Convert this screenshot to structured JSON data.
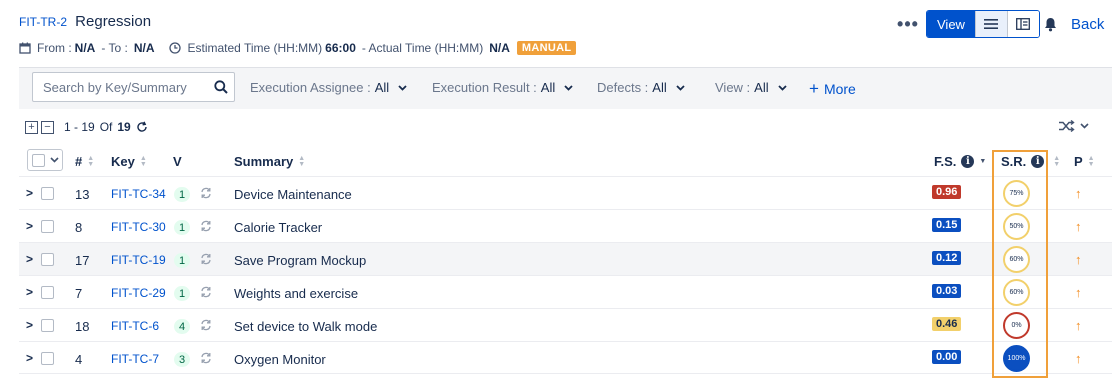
{
  "header": {
    "key": "FIT-TR-2",
    "name": "Regression",
    "from_label": "From :",
    "from_value": "N/A",
    "to_label": "- To :",
    "to_value": "N/A",
    "est_label": "Estimated Time (HH:MM)",
    "est_value": "66:00",
    "actual_label": "- Actual Time (HH:MM)",
    "actual_value": "N/A",
    "manual_badge": "MANUAL"
  },
  "toolbar": {
    "more_dots": "•••",
    "view_label": "View",
    "back_label": "Back"
  },
  "filters": {
    "search_placeholder": "Search by Key/Summary",
    "items": [
      {
        "label": "Execution Assignee :",
        "value": "All"
      },
      {
        "label": "Execution Result :",
        "value": "All"
      },
      {
        "label": "Defects :",
        "value": "All"
      },
      {
        "label": "View :",
        "value": "All"
      }
    ],
    "more_label": "More"
  },
  "pager": {
    "range": "1 - 19",
    "of_label": "Of",
    "total": "19"
  },
  "columns": {
    "num": "#",
    "key": "Key",
    "version": "V",
    "summary": "Summary",
    "fs": "F.S.",
    "sr": "S.R.",
    "priority": "P"
  },
  "rows": [
    {
      "num": "13",
      "key": "FIT-TC-34",
      "version": "1",
      "summary": "Device Maintenance",
      "fs": "0.96",
      "fs_color": "#c0392b",
      "sr": "75%",
      "sr_ring": "#f2d06b",
      "sr_fill": "#ffffff",
      "sr_text": "#172b4d"
    },
    {
      "num": "8",
      "key": "FIT-TC-30",
      "version": "1",
      "summary": "Calorie Tracker",
      "fs": "0.15",
      "fs_color": "#0b4fc0",
      "sr": "50%",
      "sr_ring": "#f2d06b",
      "sr_fill": "#ffffff",
      "sr_text": "#172b4d"
    },
    {
      "num": "17",
      "key": "FIT-TC-19",
      "version": "1",
      "summary": "Save Program Mockup",
      "fs": "0.12",
      "fs_color": "#0b4fc0",
      "sr": "60%",
      "sr_ring": "#f2d06b",
      "sr_fill": "#ffffff",
      "sr_text": "#172b4d"
    },
    {
      "num": "7",
      "key": "FIT-TC-29",
      "version": "1",
      "summary": "Weights and exercise",
      "fs": "0.03",
      "fs_color": "#0b4fc0",
      "sr": "60%",
      "sr_ring": "#f2d06b",
      "sr_fill": "#ffffff",
      "sr_text": "#172b4d"
    },
    {
      "num": "18",
      "key": "FIT-TC-6",
      "version": "4",
      "summary": "Set device to Walk mode",
      "fs": "0.46",
      "fs_color": "#f2d06b",
      "sr": "0%",
      "sr_ring": "#c0392b",
      "sr_fill": "#ffffff",
      "sr_text": "#172b4d"
    },
    {
      "num": "4",
      "key": "FIT-TC-7",
      "version": "3",
      "summary": "Oxygen Monitor",
      "fs": "0.00",
      "fs_color": "#0b4fc0",
      "sr": "100%",
      "sr_ring": "#0b4fc0",
      "sr_fill": "#0b4fc0",
      "sr_text": "#ffffff"
    }
  ],
  "colors": {
    "accent": "#0052cc",
    "highlight": "#f0a03a",
    "priority": "#f38c1f"
  }
}
